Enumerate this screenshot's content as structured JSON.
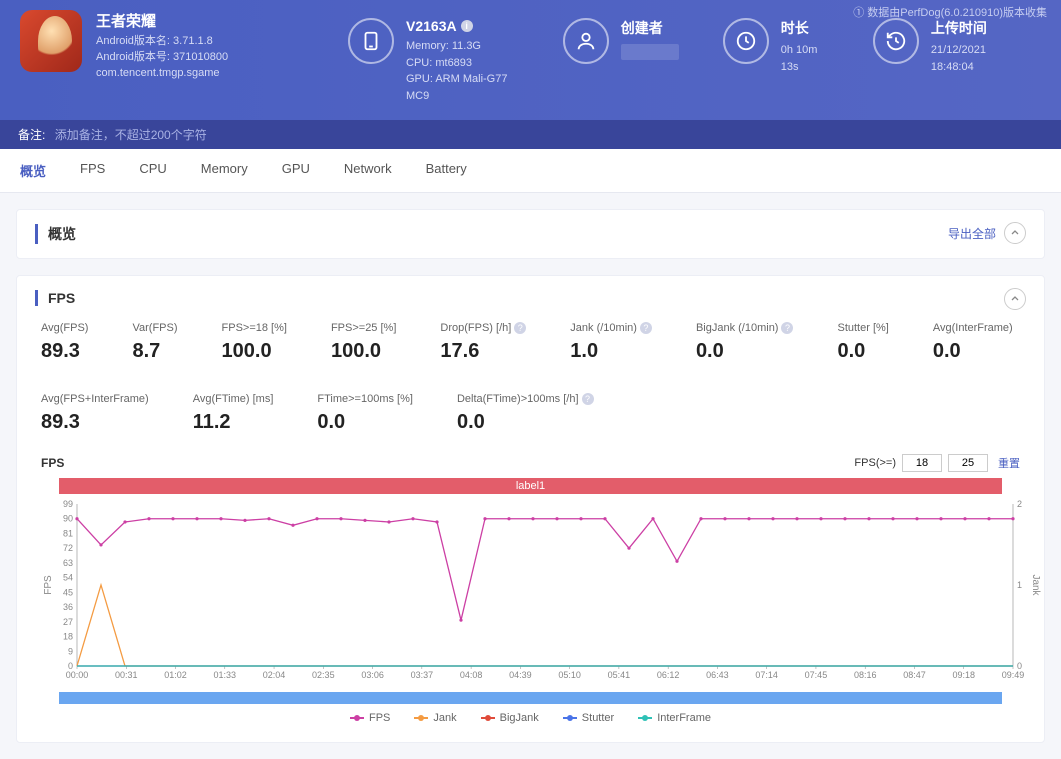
{
  "source_note": "① 数据由PerfDog(6.0.210910)版本收集",
  "app": {
    "title": "王者荣耀",
    "ver_name_label": "Android版本名: ",
    "ver_name": "3.71.1.8",
    "ver_code_label": "Android版本号: ",
    "ver_code": "371010800",
    "package": "com.tencent.tmgp.sgame"
  },
  "device": {
    "model": "V2163A",
    "memory_label": "Memory: ",
    "memory": "11.3G",
    "cpu_label": "CPU: ",
    "cpu": "mt6893",
    "gpu_label": "GPU: ",
    "gpu": "ARM Mali-G77 MC9"
  },
  "creator": {
    "label": "创建者"
  },
  "duration": {
    "label": "时长",
    "value": "0h 10m 13s"
  },
  "upload": {
    "label": "上传时间",
    "value": "21/12/2021 18:48:04"
  },
  "remark": {
    "label": "备注:",
    "placeholder": "添加备注，不超过200个字符"
  },
  "tabs": [
    "概览",
    "FPS",
    "CPU",
    "Memory",
    "GPU",
    "Network",
    "Battery"
  ],
  "overview": {
    "title": "概览",
    "export": "导出全部"
  },
  "fps_section": {
    "title": "FPS",
    "metrics": [
      {
        "label": "Avg(FPS)",
        "value": "89.3"
      },
      {
        "label": "Var(FPS)",
        "value": "8.7"
      },
      {
        "label": "FPS>=18 [%]",
        "value": "100.0"
      },
      {
        "label": "FPS>=25 [%]",
        "value": "100.0"
      },
      {
        "label": "Drop(FPS) [/h]",
        "value": "17.6",
        "help": true
      },
      {
        "label": "Jank (/10min)",
        "value": "1.0",
        "help": true
      },
      {
        "label": "BigJank (/10min)",
        "value": "0.0",
        "help": true
      },
      {
        "label": "Stutter [%]",
        "value": "0.0"
      },
      {
        "label": "Avg(InterFrame)",
        "value": "0.0"
      },
      {
        "label": "Avg(FPS+InterFrame)",
        "value": "89.3"
      },
      {
        "label": "Avg(FTime) [ms]",
        "value": "11.2"
      },
      {
        "label": "FTime>=100ms [%]",
        "value": "0.0"
      },
      {
        "label": "Delta(FTime)>100ms [/h]",
        "value": "0.0",
        "help": true
      }
    ],
    "chart_title": "FPS",
    "filter_label": "FPS(>=)",
    "filter_a": "18",
    "filter_b": "25",
    "filter_reset": "重置",
    "label_name": "label1"
  },
  "legend": {
    "fps": "FPS",
    "jank": "Jank",
    "bigjank": "BigJank",
    "stutter": "Stutter",
    "interframe": "InterFrame"
  },
  "chart_data": {
    "type": "line",
    "title": "FPS",
    "x": [
      "00:00",
      "00:31",
      "01:02",
      "01:33",
      "02:04",
      "02:35",
      "03:06",
      "03:37",
      "04:08",
      "04:39",
      "05:10",
      "05:41",
      "06:12",
      "06:43",
      "07:14",
      "07:45",
      "08:16",
      "08:47",
      "09:18",
      "09:49"
    ],
    "y_left_ticks": [
      0,
      9,
      18,
      27,
      36,
      45,
      54,
      63,
      72,
      81,
      90,
      99
    ],
    "y_right_ticks": [
      0,
      1,
      2
    ],
    "ylim_left": [
      0,
      99
    ],
    "ylim_right": [
      0,
      2
    ],
    "y_left_label": "FPS",
    "y_right_label": "Jank",
    "series": [
      {
        "name": "FPS",
        "color": "#cc3fa4",
        "axis": "left",
        "values": [
          90,
          74,
          88,
          90,
          90,
          90,
          90,
          89,
          90,
          86,
          90,
          90,
          89,
          88,
          90,
          88,
          28,
          90,
          90,
          90,
          90,
          90,
          90,
          72,
          90,
          64,
          90,
          90,
          90,
          90,
          90,
          90,
          90,
          90,
          90,
          90,
          90,
          90,
          90,
          90
        ]
      },
      {
        "name": "Jank",
        "color": "#f49b42",
        "axis": "right",
        "values": [
          0,
          1,
          0,
          0,
          0,
          0,
          0,
          0,
          0,
          0,
          0,
          0,
          0,
          0,
          0,
          0,
          0,
          0,
          0,
          0,
          0,
          0,
          0,
          0,
          0,
          0,
          0,
          0,
          0,
          0,
          0,
          0,
          0,
          0,
          0,
          0,
          0,
          0,
          0,
          0
        ]
      },
      {
        "name": "BigJank",
        "color": "#e04b3a",
        "axis": "left",
        "values": [
          0,
          0,
          0,
          0,
          0,
          0,
          0,
          0,
          0,
          0,
          0,
          0,
          0,
          0,
          0,
          0,
          0,
          0,
          0,
          0,
          0,
          0,
          0,
          0,
          0,
          0,
          0,
          0,
          0,
          0,
          0,
          0,
          0,
          0,
          0,
          0,
          0,
          0,
          0,
          0
        ]
      },
      {
        "name": "Stutter",
        "color": "#4a74e8",
        "axis": "left",
        "values": [
          0,
          0,
          0,
          0,
          0,
          0,
          0,
          0,
          0,
          0,
          0,
          0,
          0,
          0,
          0,
          0,
          0,
          0,
          0,
          0,
          0,
          0,
          0,
          0,
          0,
          0,
          0,
          0,
          0,
          0,
          0,
          0,
          0,
          0,
          0,
          0,
          0,
          0,
          0,
          0
        ]
      },
      {
        "name": "InterFrame",
        "color": "#2fc1b6",
        "axis": "left",
        "values": [
          0,
          0,
          0,
          0,
          0,
          0,
          0,
          0,
          0,
          0,
          0,
          0,
          0,
          0,
          0,
          0,
          0,
          0,
          0,
          0,
          0,
          0,
          0,
          0,
          0,
          0,
          0,
          0,
          0,
          0,
          0,
          0,
          0,
          0,
          0,
          0,
          0,
          0,
          0,
          0
        ]
      }
    ]
  }
}
